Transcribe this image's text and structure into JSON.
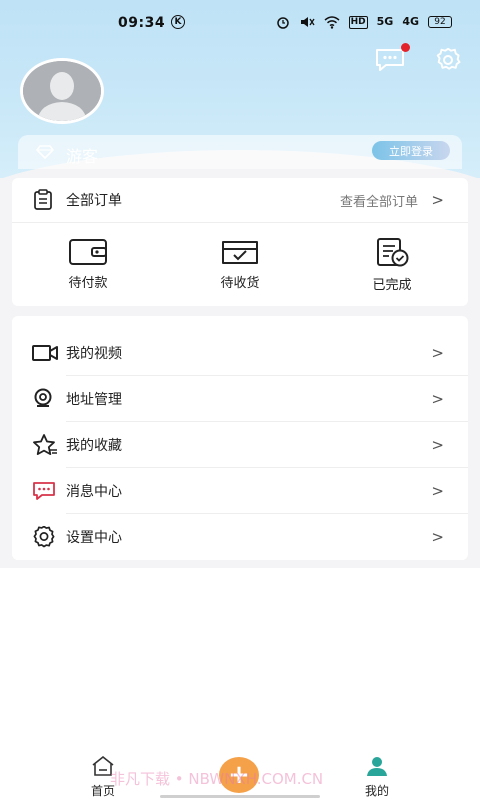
{
  "status_bar": {
    "time": "09:34",
    "k_badge": "K",
    "hd_label": "HD",
    "network_1": "5G",
    "network_2": "4G",
    "battery": "92"
  },
  "header": {
    "guest_name": "游客",
    "login_button": "立即登录",
    "has_unread_messages": true,
    "icons": {
      "messages": "chat-bubble-icon",
      "settings": "gear-icon"
    }
  },
  "orders": {
    "title": "全部订单",
    "view_all": "查看全部订单",
    "chevron": ">",
    "options": [
      {
        "label": "待付款",
        "icon": "wallet-icon"
      },
      {
        "label": "待收货",
        "icon": "inbox-check-icon"
      },
      {
        "label": "已完成",
        "icon": "checklist-done-icon"
      }
    ]
  },
  "menu": {
    "items": [
      {
        "label": "我的视频",
        "icon": "video-camera-icon"
      },
      {
        "label": "地址管理",
        "icon": "location-pin-icon"
      },
      {
        "label": "我的收藏",
        "icon": "star-icon"
      },
      {
        "label": "消息中心",
        "icon": "message-bubble-icon"
      },
      {
        "label": "设置中心",
        "icon": "gear-icon"
      }
    ],
    "chevron": ">"
  },
  "tabbar": {
    "home": "首页",
    "center_icon": "+",
    "me": "我的"
  },
  "watermark": "非凡下载 • NBWNXH.COM.CN",
  "colors": {
    "header_top": "#bfe2f6",
    "accent_orange": "#f5a14a",
    "badge_red": "#e3232b",
    "message_icon_red": "#d8334a",
    "tab_me_teal": "#2aa59a"
  }
}
